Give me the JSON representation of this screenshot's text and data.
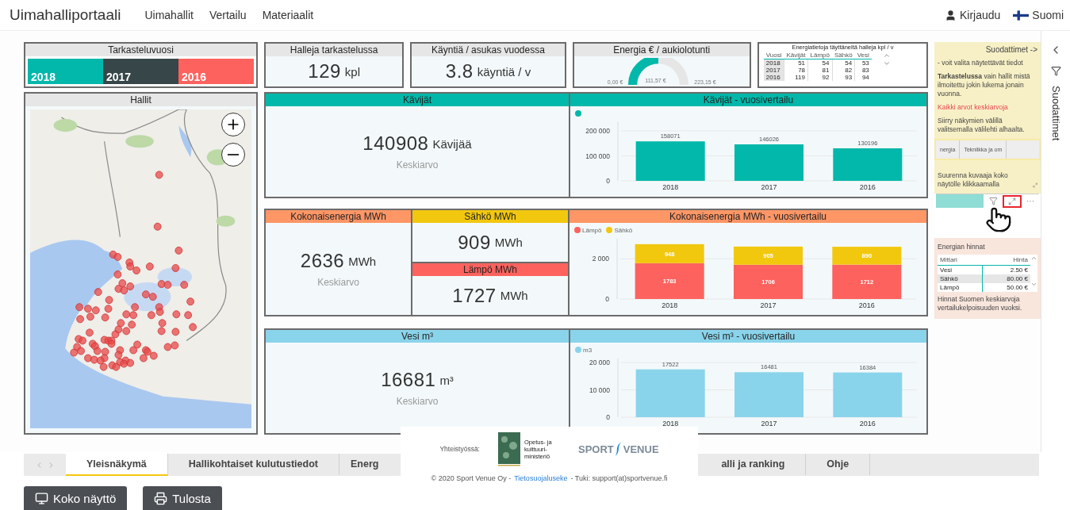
{
  "header": {
    "title": "Uimahalliportaali",
    "nav": [
      "Uimahallit",
      "Vertailu",
      "Materiaalit"
    ],
    "login": "Kirjaudu",
    "language": "Suomi"
  },
  "year_selector": {
    "title": "Tarkasteluvuosi",
    "years": [
      {
        "label": "2018",
        "color": "#01b8aa"
      },
      {
        "label": "2017",
        "color": "#374649"
      },
      {
        "label": "2016",
        "color": "#fd625e"
      }
    ]
  },
  "map": {
    "title": "Hallit"
  },
  "kpis": [
    {
      "kind": "value",
      "title": "Halleja tarkastelussa",
      "value": "129",
      "unit": "kpl"
    },
    {
      "kind": "value",
      "title": "Käyntiä / asukas vuodessa",
      "value": "3.8",
      "unit": "käyntiä / v"
    },
    {
      "kind": "gauge",
      "title": "Energia € / aukiolotunti",
      "min": "0,00 €",
      "value": "111,57 €",
      "max": "223,15 €",
      "level": 0.5
    }
  ],
  "energy_table": {
    "title": "Energiatietoja täyttäneitä halleja kpl / v",
    "columns": [
      "Vuosi",
      "Kävijät",
      "Lämpö",
      "Sähkö",
      "Vesi"
    ],
    "rows": [
      [
        "2018",
        "51",
        "54",
        "54",
        "53"
      ],
      [
        "2017",
        "78",
        "81",
        "82",
        "83"
      ],
      [
        "2016",
        "119",
        "92",
        "93",
        "94"
      ]
    ]
  },
  "visitors": {
    "card": {
      "title": "Kävijät",
      "value": "140908",
      "unit": "Kävijää",
      "caption": "Keskiarvo"
    },
    "chart": {
      "title": "Kävijät - vuosivertailu",
      "chart_data": {
        "type": "bar",
        "categories": [
          "2018",
          "2017",
          "2016"
        ],
        "series": [
          {
            "color": "#01b8aa",
            "values": [
              158071,
              146026,
              130196
            ]
          }
        ],
        "ylim": [
          0,
          235000
        ],
        "yticks": [
          0,
          {
            "value": 100000,
            "label": "100 000"
          },
          {
            "value": 200000,
            "label": "200 000"
          }
        ],
        "data_labels": true
      }
    }
  },
  "energy": {
    "total": {
      "title": "Kokonaisenergia MWh",
      "value": "2636",
      "unit": "MWh",
      "caption": "Keskiarvo"
    },
    "electricity": {
      "title": "Sähkö MWh",
      "value": "909",
      "unit": "MWh"
    },
    "heat": {
      "title": "Lämpö MWh",
      "value": "1727",
      "unit": "MWh"
    },
    "chart": {
      "title": "Kokonaisenergia MWh - vuosivertailu",
      "chart_data": {
        "type": "bar",
        "stacked": true,
        "categories": [
          "2018",
          "2017",
          "2016"
        ],
        "series": [
          {
            "name": "Lämpö",
            "color": "#fd625e",
            "values": [
              1783,
              1706,
              1712
            ]
          },
          {
            "name": "Sähkö",
            "color": "#f2c80f",
            "values": [
              948,
              905,
              890
            ]
          }
        ],
        "ylim": [
          0,
          3000
        ],
        "yticks": [
          0,
          {
            "value": 2000,
            "label": "2 000"
          }
        ],
        "data_labels": true
      }
    }
  },
  "water": {
    "card": {
      "title": "Vesi m³",
      "value": "16681",
      "unit": "m³",
      "caption": "Keskiarvo"
    },
    "chart": {
      "title": "Vesi m³ - vuosivertailu",
      "chart_data": {
        "type": "bar",
        "categories": [
          "2018",
          "2017",
          "2016"
        ],
        "series": [
          {
            "name": "m3",
            "color": "#8ad4eb",
            "values": [
              17522,
              16481,
              16384
            ]
          }
        ],
        "ylim": [
          0,
          21500
        ],
        "yticks": [
          0,
          {
            "value": 10000,
            "label": "10 000"
          },
          {
            "value": 20000,
            "label": "20 000"
          }
        ],
        "data_labels": true
      }
    }
  },
  "filter_panel": {
    "notes": [
      {
        "kind": "title",
        "text": "Suodattimet ->"
      },
      {
        "kind": "plain",
        "text": "- voit valita  näytettävät tiedot"
      },
      {
        "kind": "plain",
        "text": "**Tarkastelussa** vain hallit mistä ilmoitettu jokin lukema jonain vuonna."
      },
      {
        "kind": "warning",
        "text": "Kaikki arvot keskiarvoja"
      },
      {
        "kind": "plain",
        "text": "Siirry näkymien välillä valitsemalla välilehti alhaalta."
      }
    ],
    "mini_tabs": [
      "nergia",
      "Tekniikka ja om"
    ],
    "hint": "Suurenna kuvaaja koko näytölle klikkaamalla",
    "focus_highlighted": true,
    "more": "···"
  },
  "prices": {
    "title": "Energian hinnat",
    "columns": [
      "Mittari",
      "Hinta"
    ],
    "rows": [
      {
        "label": "Vesi",
        "price": "2.50 €",
        "selected": false
      },
      {
        "label": "Sähkö",
        "price": "80.00 €",
        "selected": true
      },
      {
        "label": "Lämpö",
        "price": "50.00 €",
        "selected": false
      }
    ],
    "note": "Hinnat Suomen keskiarvoja vertailukelpoisuuden vuoksi."
  },
  "side_pane": {
    "label": "Suodattimet"
  },
  "tabs": [
    {
      "label": "Yleisnäkymä",
      "selected": true
    },
    {
      "label": "Hallikohtaiset kulutustiedot",
      "selected": false
    },
    {
      "label": "Energ",
      "selected": false
    },
    {
      "label": "alli ja ranking",
      "selected": false
    },
    {
      "label": "Ohje",
      "selected": false
    }
  ],
  "buttons": [
    {
      "kind": "fullscreen",
      "label": "Koko näyttö"
    },
    {
      "kind": "print",
      "label": "Tulosta"
    }
  ],
  "footer": {
    "partner_label": "Yhteistyössä:",
    "ministry": "Opetus- ja kulttuuri-ministeriö",
    "brand_left": "SPORT",
    "brand_right": "VENUE",
    "copyright": "© 2020 Sport Venue Oy -",
    "privacy_link": "Tietosuojaluseke",
    "support": "- Tuki: support(at)sportvenue.fi"
  }
}
